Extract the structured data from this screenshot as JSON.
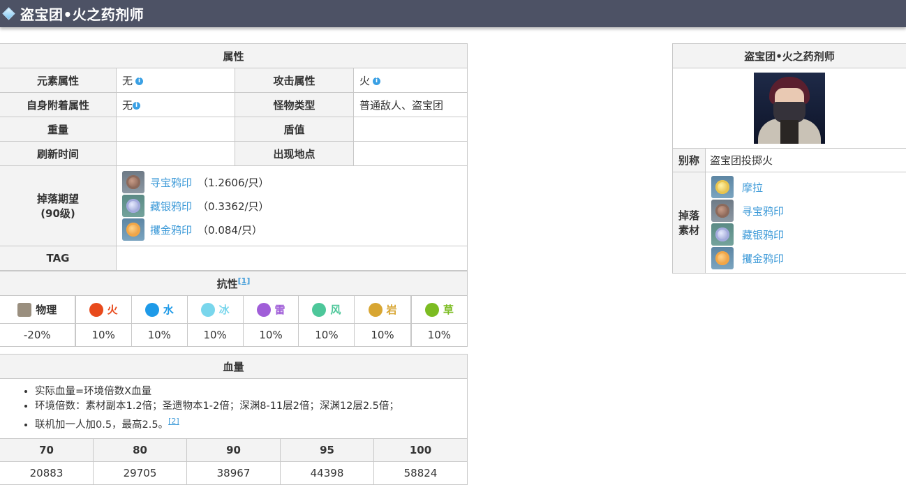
{
  "page_title": "盗宝团•火之药剂师",
  "attributes": {
    "caption": "属性",
    "rows": [
      {
        "l1": "元素属性",
        "v1": "无",
        "i1": true,
        "l2": "攻击属性",
        "v2": "火",
        "i2": true
      },
      {
        "l1": "自身附着属性",
        "v1": "无",
        "i1": true,
        "l2": "怪物类型",
        "v2": "普通敌人、盗宝团",
        "i2": false
      },
      {
        "l1": "重量",
        "v1": "",
        "l2": "盾值",
        "v2": ""
      },
      {
        "l1": "刷新时间",
        "v1": "",
        "l2": "出现地点",
        "v2": ""
      }
    ],
    "drop_label": "掉落期望",
    "drop_level": "(90级)",
    "drops": [
      {
        "name": "寻宝鸦印",
        "qty": "（1.2606/只）",
        "icon": "crow-seal-brown-icon"
      },
      {
        "name": "藏银鸦印",
        "qty": "（0.3362/只）",
        "icon": "crow-seal-silver-icon"
      },
      {
        "name": "攫金鸦印",
        "qty": "（0.084/只）",
        "icon": "crow-seal-gold-icon"
      }
    ],
    "tag_label": "TAG",
    "tag_value": ""
  },
  "resistance": {
    "caption": "抗性",
    "ref": "[1]",
    "elements": [
      {
        "name": "物理",
        "value": "-20%",
        "color": "#9a8f7f"
      },
      {
        "name": "火",
        "value": "10%",
        "color": "#e84a1c"
      },
      {
        "name": "水",
        "value": "10%",
        "color": "#1e9ae8"
      },
      {
        "name": "冰",
        "value": "10%",
        "color": "#79d6ec"
      },
      {
        "name": "雷",
        "value": "10%",
        "color": "#a05ed8"
      },
      {
        "name": "风",
        "value": "10%",
        "color": "#4dc79a"
      },
      {
        "name": "岩",
        "value": "10%",
        "color": "#d8a632"
      },
      {
        "name": "草",
        "value": "10%",
        "color": "#7cbc22"
      }
    ]
  },
  "hp": {
    "caption": "血量",
    "notes": [
      "实际血量=环境倍数X血量",
      "环境倍数：素材副本1.2倍；圣遗物本1-2倍；深渊8-11层2倍；深渊12层2.5倍；",
      "联机加一人加0.5，最高2.5。"
    ],
    "note_ref": "[2]",
    "levels": [
      "70",
      "80",
      "90",
      "95",
      "100"
    ],
    "values": [
      "20883",
      "29705",
      "38967",
      "44398",
      "58824"
    ]
  },
  "card": {
    "title": "盗宝团•火之药剂师",
    "alias_label": "别称",
    "alias_value": "盗宝团投掷火",
    "materials_label_1": "掉落",
    "materials_label_2": "素材",
    "materials": [
      {
        "name": "摩拉",
        "icon": "mora-coin-icon"
      },
      {
        "name": "寻宝鸦印",
        "icon": "crow-seal-brown-icon"
      },
      {
        "name": "藏银鸦印",
        "icon": "crow-seal-silver-icon"
      },
      {
        "name": "攫金鸦印",
        "icon": "crow-seal-gold-icon"
      }
    ]
  }
}
